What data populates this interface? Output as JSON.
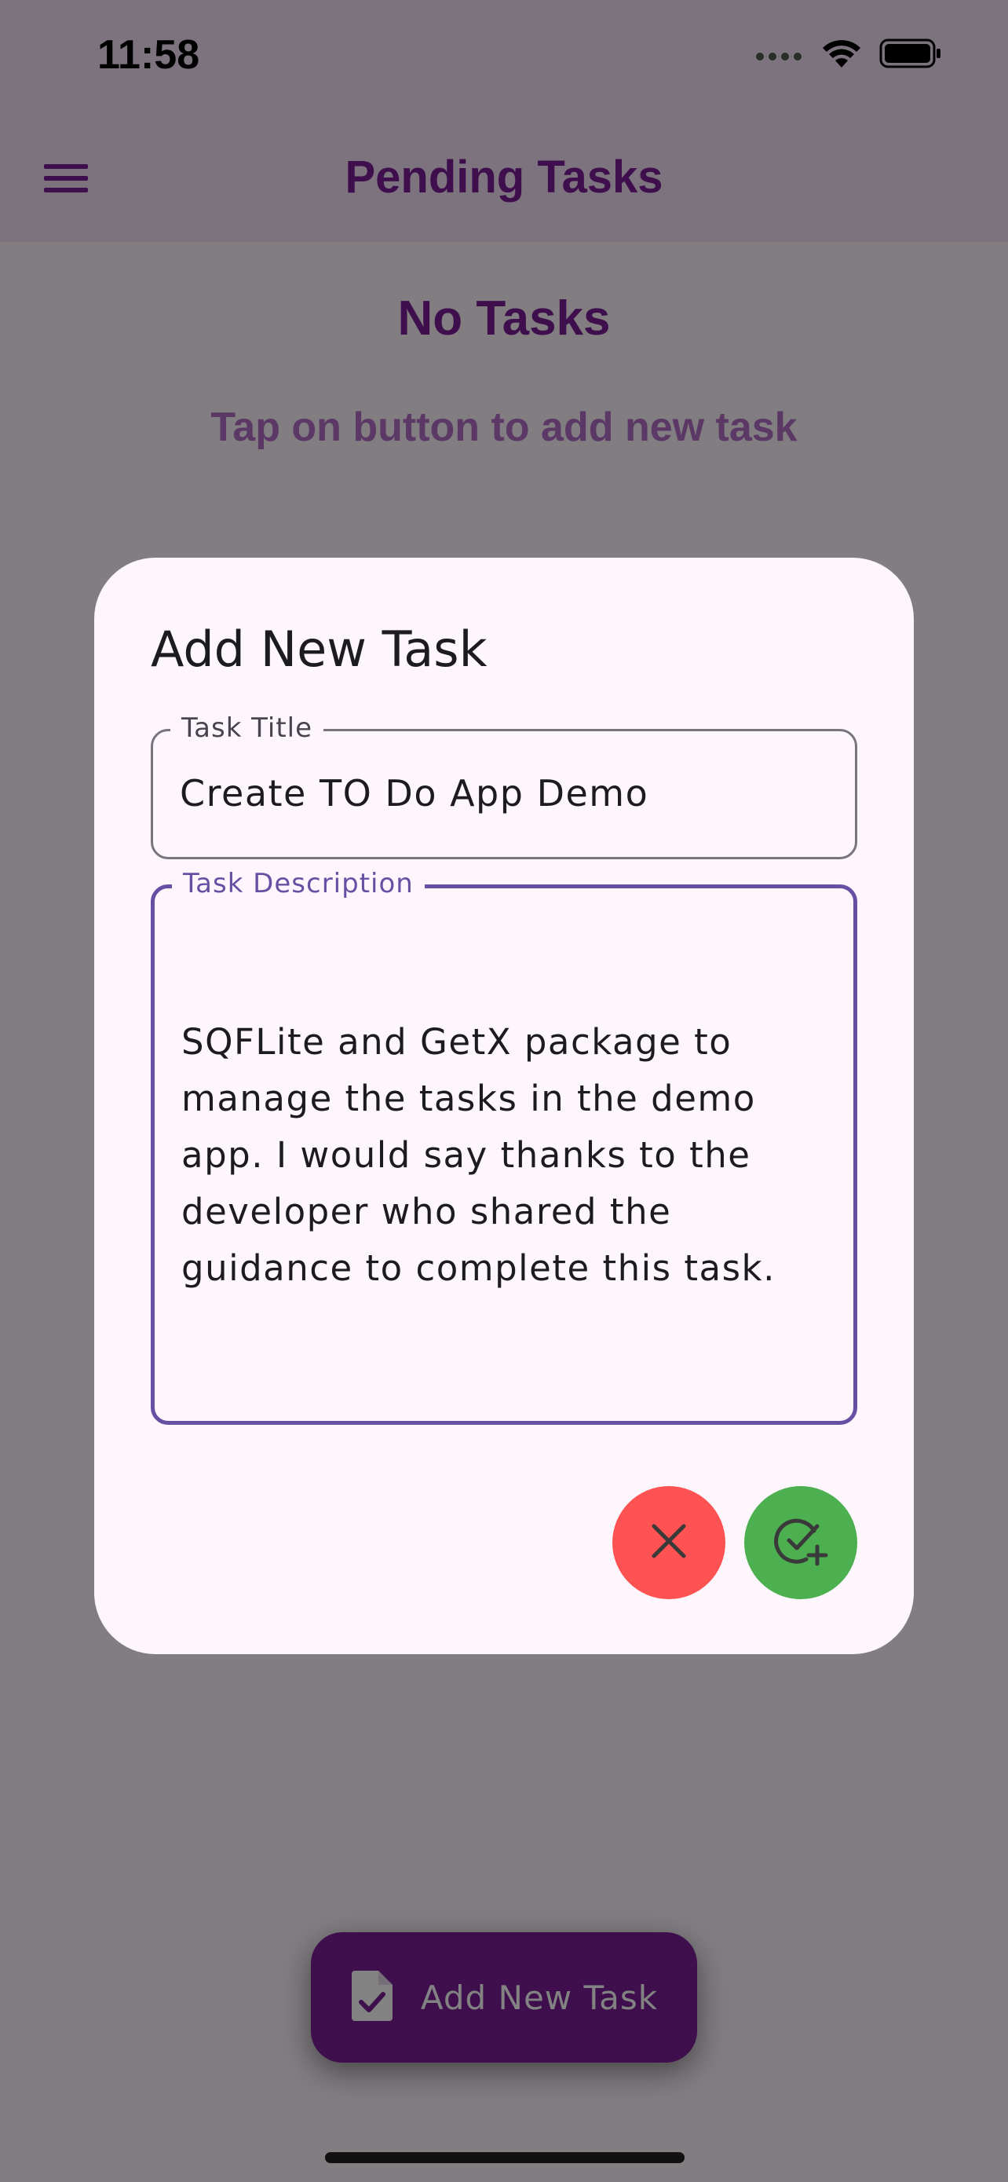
{
  "status_bar": {
    "time": "11:58"
  },
  "app_bar": {
    "title": "Pending Tasks",
    "menu_icon": "menu-icon"
  },
  "empty_state": {
    "title": "No Tasks",
    "subtitle": "Tap on button to add new task"
  },
  "dialog": {
    "title": "Add New Task",
    "task_title": {
      "label": "Task Title",
      "value": "Create TO Do App Demo"
    },
    "task_description": {
      "label": "Task Description",
      "value": "SQFLite and GetX package to\nmanage the tasks in the demo\napp. I would say thanks to the\ndeveloper who shared the\nguidance to complete this task."
    },
    "cancel_icon": "close-icon",
    "confirm_icon": "add-task-icon"
  },
  "fab": {
    "label": "Add New Task",
    "icon": "task-file-icon"
  },
  "colors": {
    "primary": "#7a1c98",
    "app_bar_bg": "#f3e1f8",
    "dialog_bg": "#fdf6fd",
    "focus_outline": "#6750a4",
    "cancel": "#ff5252",
    "confirm": "#4caf50"
  }
}
